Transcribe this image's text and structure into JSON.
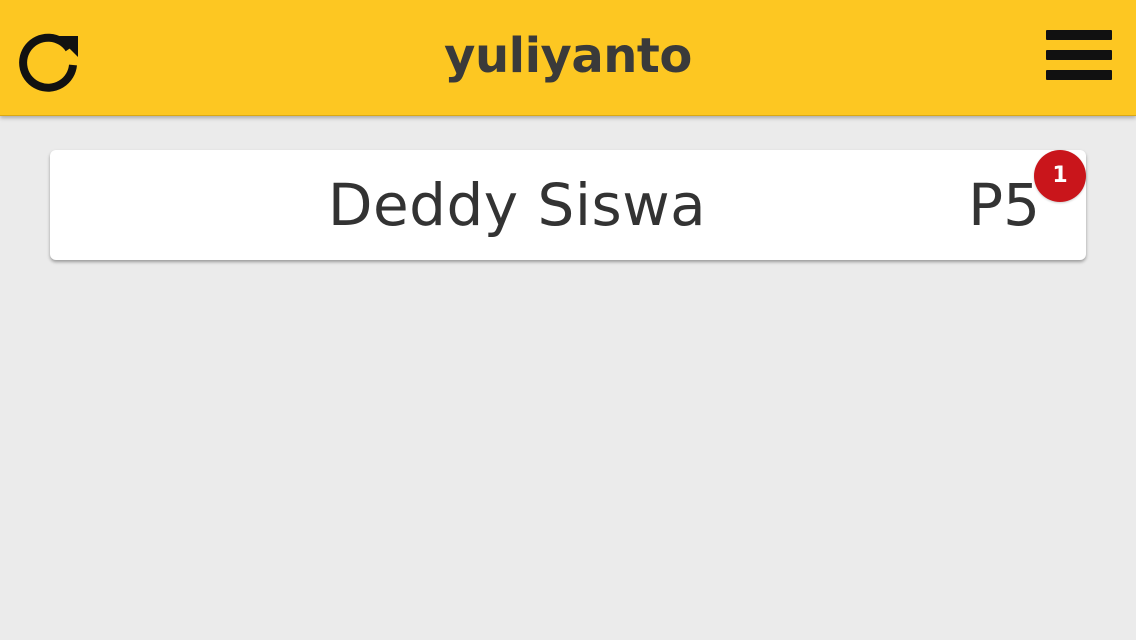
{
  "header": {
    "title": "yuliyanto",
    "refresh_icon": "refresh-icon",
    "menu_icon": "hamburger-menu-icon",
    "background_color": "#fdc722"
  },
  "list": {
    "items": [
      {
        "name": "Deddy Siswa",
        "code": "P5",
        "badge_count": "1",
        "badge_color": "#c9151b"
      }
    ]
  }
}
